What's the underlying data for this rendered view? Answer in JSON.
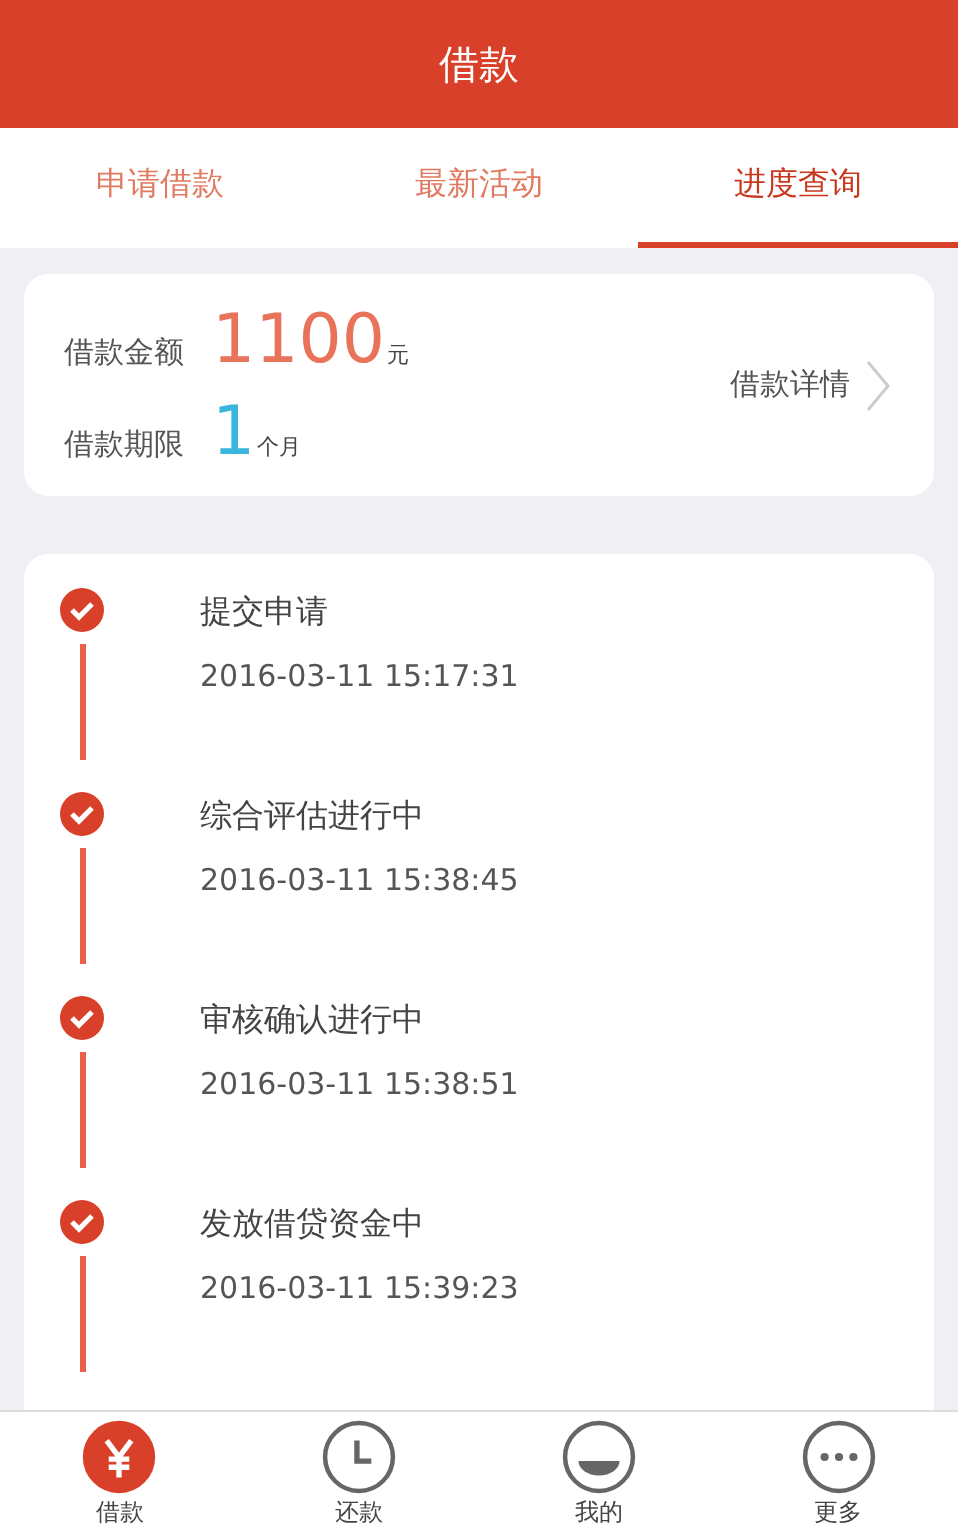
{
  "header": {
    "title": "借款"
  },
  "tabs": [
    {
      "label": "申请借款",
      "selected": false
    },
    {
      "label": "最新活动",
      "selected": false
    },
    {
      "label": "进度查询",
      "selected": true
    }
  ],
  "summary": {
    "amount_label": "借款金额",
    "amount": "1100",
    "amount_unit": "元",
    "term_label": "借款期限",
    "term": "1",
    "term_unit": "个月",
    "detail_link": "借款详情"
  },
  "steps": [
    {
      "title": "提交申请",
      "time": "2016-03-11 15:17:31",
      "done": true
    },
    {
      "title": "综合评估进行中",
      "time": "2016-03-11 15:38:45",
      "done": true
    },
    {
      "title": "审核确认进行中",
      "time": "2016-03-11 15:38:51",
      "done": true
    },
    {
      "title": "发放借贷资金中",
      "time": "2016-03-11 15:39:23",
      "done": true
    }
  ],
  "nav": [
    {
      "kind": "yen",
      "label": "借款",
      "selected": true
    },
    {
      "kind": "clock",
      "label": "还款",
      "selected": false
    },
    {
      "kind": "face",
      "label": "我的",
      "selected": false
    },
    {
      "kind": "more",
      "label": "更多",
      "selected": false
    }
  ]
}
